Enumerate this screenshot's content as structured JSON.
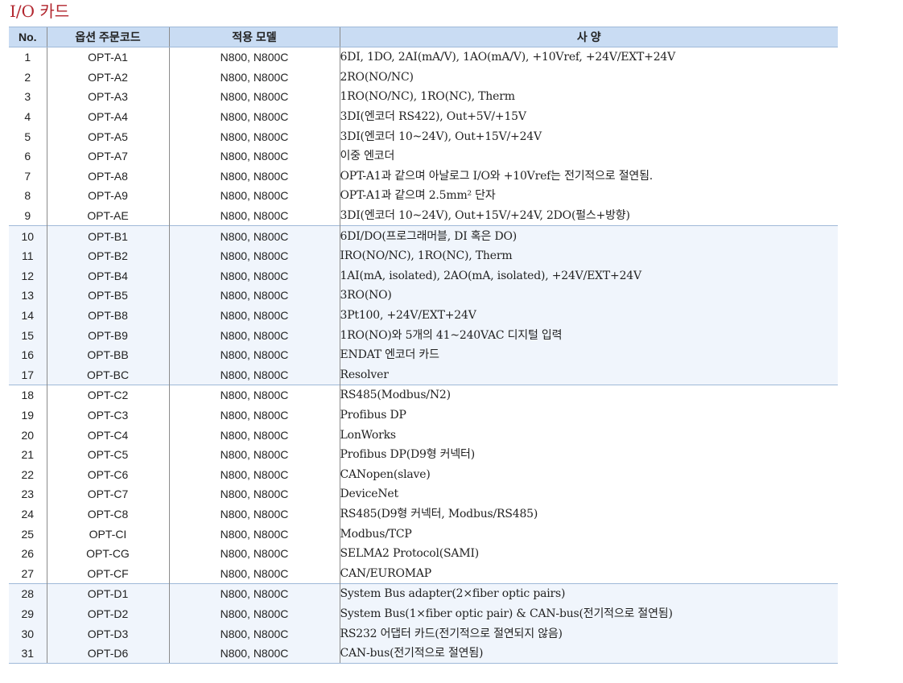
{
  "title": "I/O 카드",
  "table": {
    "headers": {
      "no": "No.",
      "code": "옵션 주문코드",
      "model": "적용 모델",
      "spec": "사 양"
    },
    "rows": [
      {
        "no": "1",
        "code": "OPT-A1",
        "model": "N800, N800C",
        "spec": "6DI, 1DO, 2AI(mA/V), 1AO(mA/V), +10Vref, +24V/EXT+24V",
        "group": "A"
      },
      {
        "no": "2",
        "code": "OPT-A2",
        "model": "N800, N800C",
        "spec": "2RO(NO/NC)",
        "group": "A"
      },
      {
        "no": "3",
        "code": "OPT-A3",
        "model": "N800, N800C",
        "spec": "1RO(NO/NC), 1RO(NC), Therm",
        "group": "A"
      },
      {
        "no": "4",
        "code": "OPT-A4",
        "model": "N800, N800C",
        "spec": "3DI(엔코더 RS422), Out+5V/+15V",
        "group": "A"
      },
      {
        "no": "5",
        "code": "OPT-A5",
        "model": "N800, N800C",
        "spec": "3DI(엔코더 10~24V), Out+15V/+24V",
        "group": "A"
      },
      {
        "no": "6",
        "code": "OPT-A7",
        "model": "N800, N800C",
        "spec": "이중 엔코더",
        "group": "A"
      },
      {
        "no": "7",
        "code": "OPT-A8",
        "model": "N800, N800C",
        "spec": "OPT-A1과 같으며 아날로그 I/O와 +10Vref는 전기적으로 절연됨.",
        "group": "A"
      },
      {
        "no": "8",
        "code": "OPT-A9",
        "model": "N800, N800C",
        "spec": "OPT-A1과 같으며 2.5mm² 단자",
        "group": "A"
      },
      {
        "no": "9",
        "code": "OPT-AE",
        "model": "N800, N800C",
        "spec": "3DI(엔코더 10~24V), Out+15V/+24V, 2DO(펄스+방향)",
        "group": "A"
      },
      {
        "no": "10",
        "code": "OPT-B1",
        "model": "N800, N800C",
        "spec": "6DI/DO(프로그래머블, DI 혹은 DO)",
        "group": "B"
      },
      {
        "no": "11",
        "code": "OPT-B2",
        "model": "N800, N800C",
        "spec": "IRO(NO/NC), 1RO(NC), Therm",
        "group": "B"
      },
      {
        "no": "12",
        "code": "OPT-B4",
        "model": "N800, N800C",
        "spec": "1AI(mA, isolated), 2AO(mA, isolated), +24V/EXT+24V",
        "group": "B"
      },
      {
        "no": "13",
        "code": "OPT-B5",
        "model": "N800, N800C",
        "spec": "3RO(NO)",
        "group": "B"
      },
      {
        "no": "14",
        "code": "OPT-B8",
        "model": "N800, N800C",
        "spec": "3Pt100, +24V/EXT+24V",
        "group": "B"
      },
      {
        "no": "15",
        "code": "OPT-B9",
        "model": "N800, N800C",
        "spec": "1RO(NO)와 5개의 41~240VAC 디지털 입력",
        "group": "B"
      },
      {
        "no": "16",
        "code": "OPT-BB",
        "model": "N800, N800C",
        "spec": "ENDAT 엔코더 카드",
        "group": "B"
      },
      {
        "no": "17",
        "code": "OPT-BC",
        "model": "N800, N800C",
        "spec": "Resolver",
        "group": "B"
      },
      {
        "no": "18",
        "code": "OPT-C2",
        "model": "N800, N800C",
        "spec": "RS485(Modbus/N2)",
        "group": "C"
      },
      {
        "no": "19",
        "code": "OPT-C3",
        "model": "N800, N800C",
        "spec": "Profibus DP",
        "group": "C"
      },
      {
        "no": "20",
        "code": "OPT-C4",
        "model": "N800, N800C",
        "spec": "LonWorks",
        "group": "C"
      },
      {
        "no": "21",
        "code": "OPT-C5",
        "model": "N800, N800C",
        "spec": "Profibus DP(D9형 커넥터)",
        "group": "C"
      },
      {
        "no": "22",
        "code": "OPT-C6",
        "model": "N800, N800C",
        "spec": "CANopen(slave)",
        "group": "C"
      },
      {
        "no": "23",
        "code": "OPT-C7",
        "model": "N800, N800C",
        "spec": "DeviceNet",
        "group": "C"
      },
      {
        "no": "24",
        "code": "OPT-C8",
        "model": "N800, N800C",
        "spec": "RS485(D9형 커넥터, Modbus/RS485)",
        "group": "C"
      },
      {
        "no": "25",
        "code": "OPT-CI",
        "model": "N800, N800C",
        "spec": "Modbus/TCP",
        "group": "C"
      },
      {
        "no": "26",
        "code": "OPT-CG",
        "model": "N800, N800C",
        "spec": "SELMA2 Protocol(SAMI)",
        "group": "C"
      },
      {
        "no": "27",
        "code": "OPT-CF",
        "model": "N800, N800C",
        "spec": "CAN/EUROMAP",
        "group": "C"
      },
      {
        "no": "28",
        "code": "OPT-D1",
        "model": "N800, N800C",
        "spec": "System Bus adapter(2×fiber optic pairs)",
        "group": "D"
      },
      {
        "no": "29",
        "code": "OPT-D2",
        "model": "N800, N800C",
        "spec": "System Bus(1×fiber optic pair) & CAN-bus(전기적으로 절연됨)",
        "group": "D"
      },
      {
        "no": "30",
        "code": "OPT-D3",
        "model": "N800, N800C",
        "spec": "RS232 어댑터 카드(전기적으로 절연되지 않음)",
        "group": "D"
      },
      {
        "no": "31",
        "code": "OPT-D6",
        "model": "N800, N800C",
        "spec": "CAN-bus(전기적으로 절연됨)",
        "group": "D"
      }
    ]
  }
}
